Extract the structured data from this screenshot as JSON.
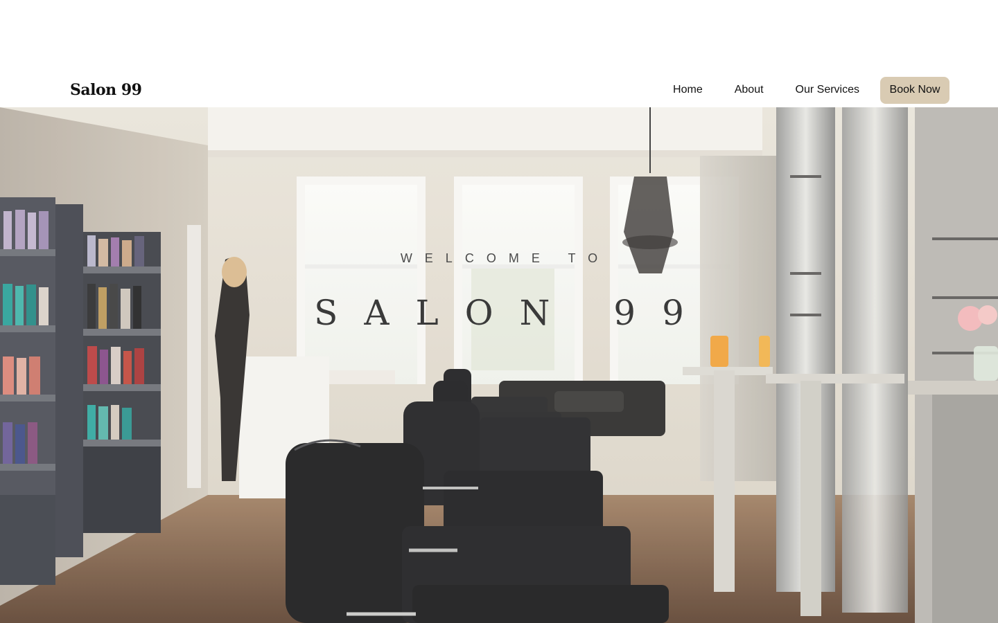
{
  "brand": {
    "name": "Salon 99"
  },
  "nav": {
    "links": [
      {
        "label": "Home"
      },
      {
        "label": "About"
      },
      {
        "label": "Our Services"
      }
    ],
    "cta_label": "Book Now",
    "cta_color": "#d9cbb3"
  },
  "hero": {
    "kicker": "WELCOME TO",
    "title": "SALON 99",
    "image": "salon-interior-photo"
  }
}
